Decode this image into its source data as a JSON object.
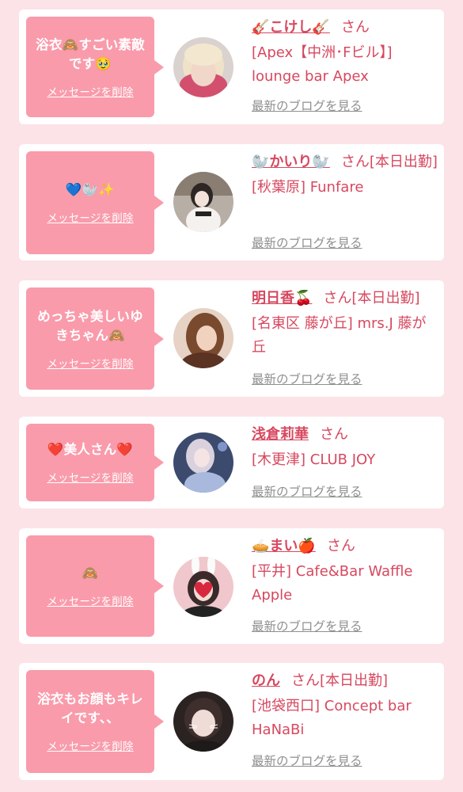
{
  "delete_label": "メッセージを削除",
  "blog_label": "最新のブログを見る",
  "items": [
    {
      "message": "浴衣🙈すごい素敵です🥹",
      "name": "🎸こけし🎸",
      "suffix": "さん",
      "shop": "[Apex【中洲･Fビル】] lounge bar Apex",
      "avatar": "blonde-pink-hair-avatar"
    },
    {
      "message": "💙🦭✨",
      "name": "🦭かいり🦭",
      "suffix": "さん[本日出勤]",
      "shop": "[秋葉原] Funfare",
      "avatar": "maid-outfit-avatar"
    },
    {
      "message": "めっちゃ美しいゆきちゃん🙈",
      "name": "明日香🍒",
      "suffix": "さん[本日出勤]",
      "shop": "[名東区 藤が丘] mrs.J 藤が丘",
      "avatar": "brown-hair-avatar"
    },
    {
      "message": "❤️美人さん❤️",
      "name": "浅倉莉華",
      "suffix": "さん",
      "shop": "[木更津] CLUB JOY",
      "avatar": "blue-dress-avatar"
    },
    {
      "message": "🙈",
      "name": "🥧まい🍎",
      "suffix": "さん",
      "shop": "[平井] Cafe&Bar Waffle Apple",
      "avatar": "bunny-ears-heart-avatar"
    },
    {
      "message": "浴衣もお顔もキレイです、、",
      "name": "のん",
      "suffix": "さん[本日出勤]",
      "shop": "[池袋西口] Concept bar HaNaBi",
      "avatar": "cat-whiskers-avatar"
    }
  ],
  "colors": {
    "background": "#fbe3e7",
    "bubble": "#f99bab",
    "accent": "#d7485f",
    "muted": "#8f8f8f"
  }
}
